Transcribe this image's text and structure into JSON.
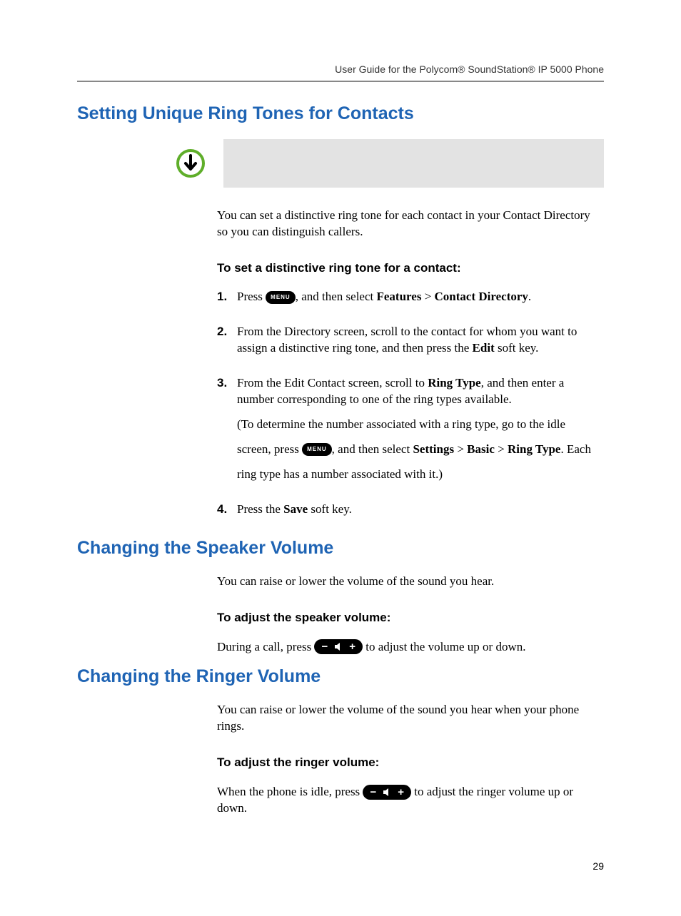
{
  "header": "User Guide for the Polycom® SoundStation® IP 5000 Phone",
  "section1": {
    "title": "Setting Unique Ring Tones for Contacts",
    "intro": "You can set a distinctive ring tone for each contact in your Contact Directory so you can distinguish callers.",
    "subhead": "To set a distinctive ring tone for a contact:",
    "steps": {
      "n1": "1.",
      "s1_a": "Press ",
      "s1_b": ", and then select ",
      "s1_bold1": "Features",
      "s1_gt": " > ",
      "s1_bold2": "Contact Directory",
      "s1_c": ".",
      "n2": "2.",
      "s2_a": "From the Directory screen, scroll to the contact for whom you want to assign a distinctive ring tone, and then press the ",
      "s2_bold": "Edit",
      "s2_b": " soft key.",
      "n3": "3.",
      "s3_a": "From the Edit Contact screen, scroll to ",
      "s3_bold": "Ring Type",
      "s3_b": ", and then enter a number corresponding to one of the ring types available.",
      "s3_c": "(To determine the number associated with a ring type, go to the idle",
      "s3_d": "screen, press ",
      "s3_e": ", and then select ",
      "s3_bold2": "Settings",
      "s3_gt1": " > ",
      "s3_bold3": "Basic",
      "s3_gt2": " > ",
      "s3_bold4": "Ring Type",
      "s3_f": ". Each",
      "s3_g": "ring type has a number associated with it.)",
      "n4": "4.",
      "s4_a": "Press the ",
      "s4_bold": "Save",
      "s4_b": " soft key."
    }
  },
  "section2": {
    "title": "Changing the Speaker Volume",
    "intro": "You can raise or lower the volume of the sound you hear.",
    "subhead": "To adjust the speaker volume:",
    "body_a": "During a call, press ",
    "body_b": " to adjust the volume up or down."
  },
  "section3": {
    "title": "Changing the Ringer Volume",
    "intro": "You can raise or lower the volume of the sound you hear when your phone rings.",
    "subhead": "To adjust the ringer volume:",
    "body_a": "When the phone is idle, press ",
    "body_b": " to adjust the ringer volume up or down."
  },
  "menu_label": "MENU",
  "page_number": "29"
}
